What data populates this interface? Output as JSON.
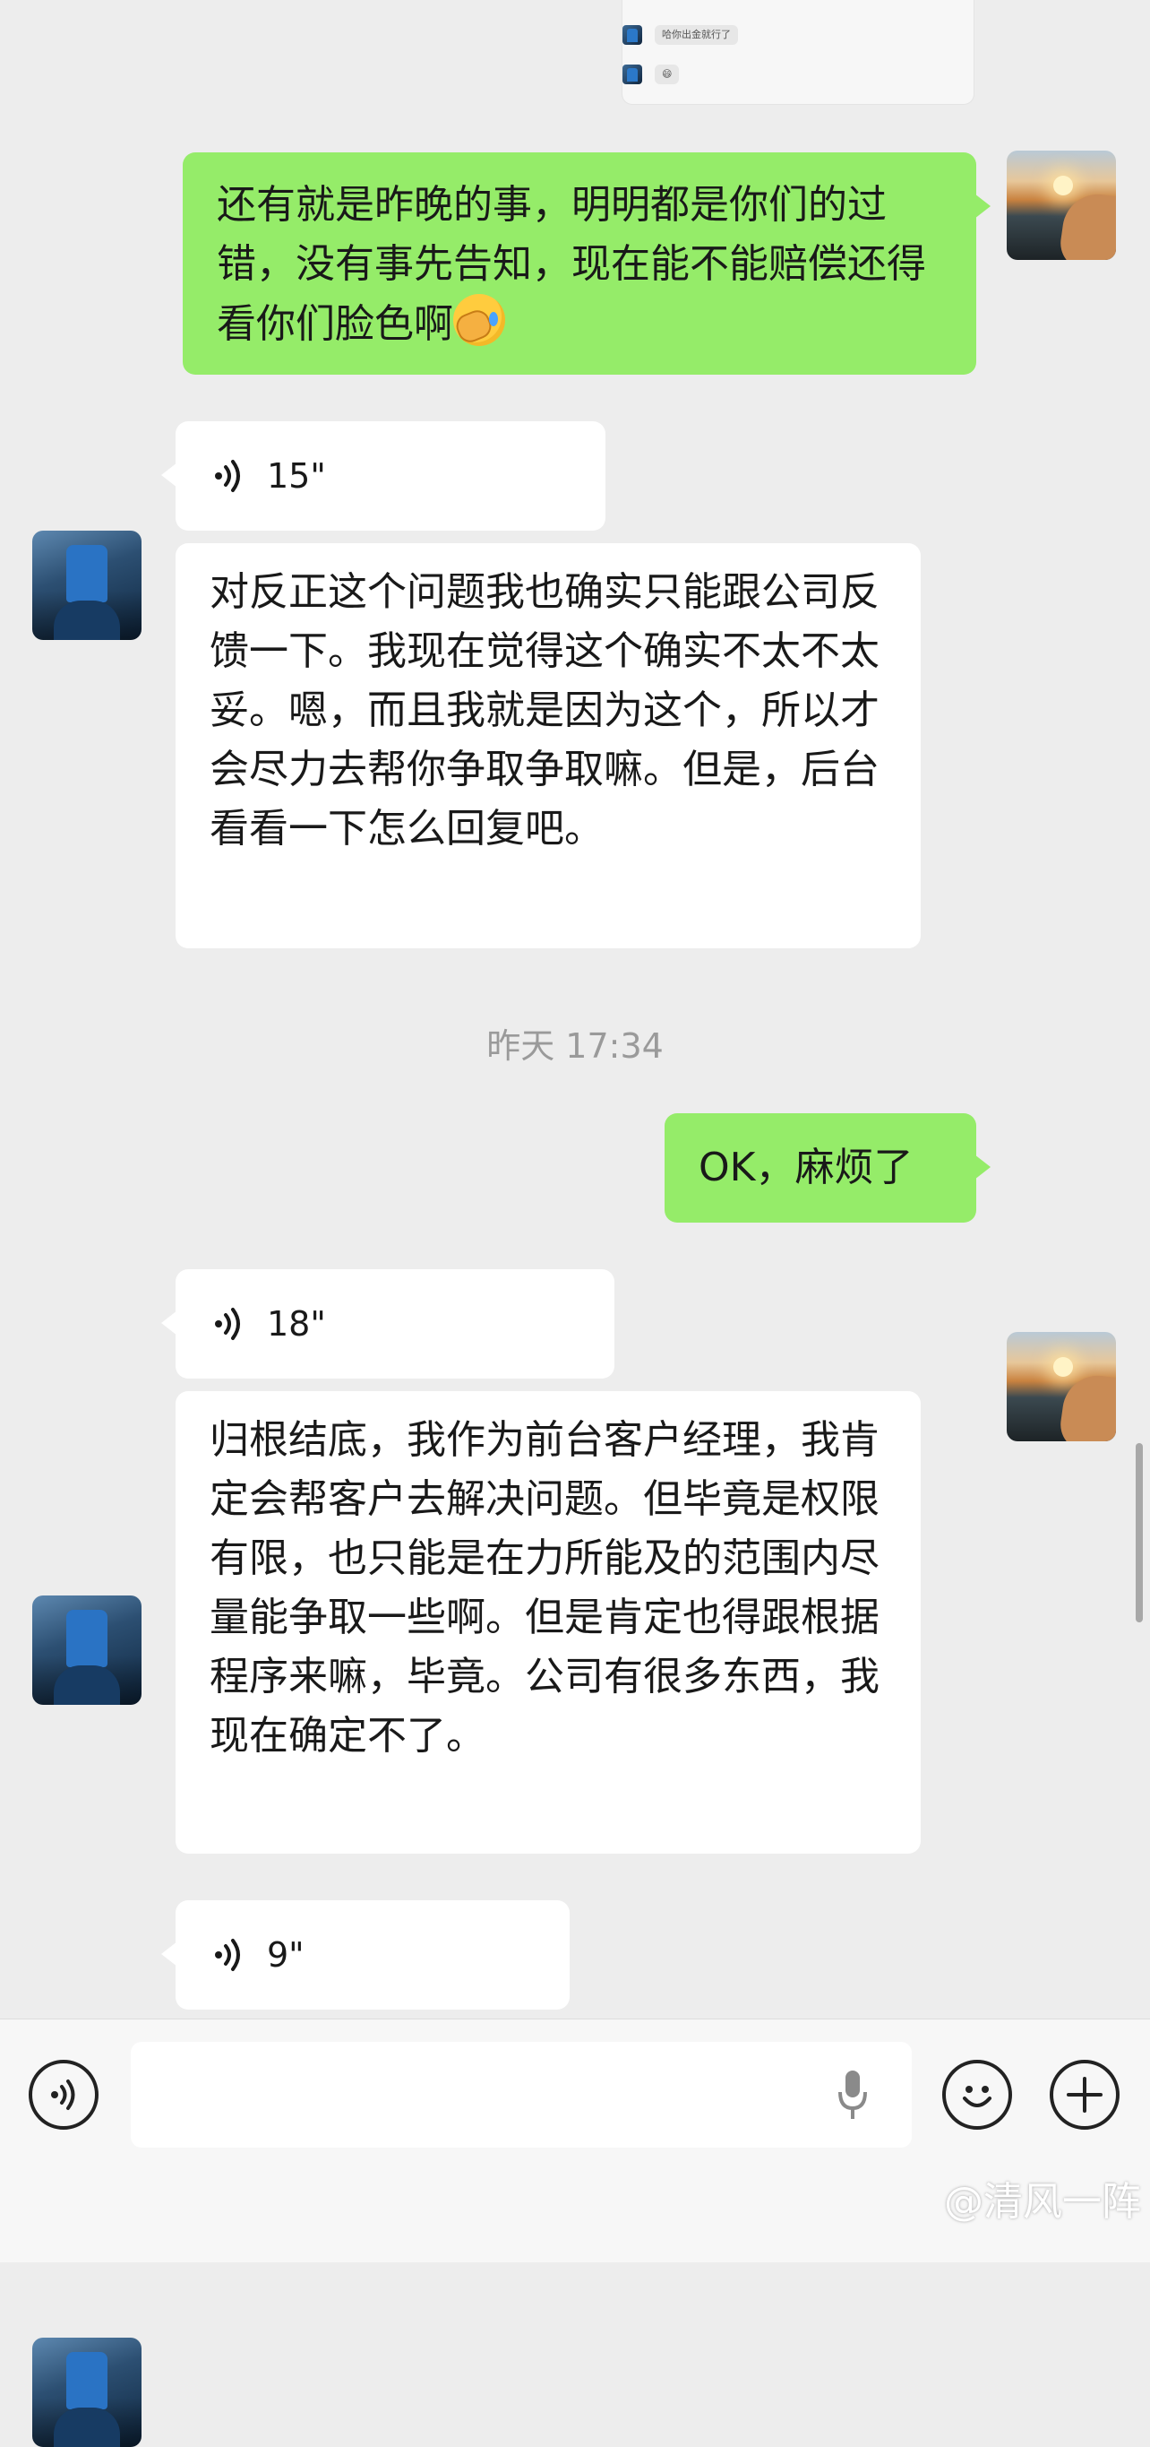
{
  "quote_card": {
    "row1_text": "哈你出金就行了",
    "row2_text": "😄"
  },
  "messages": {
    "m1": {
      "text": "还有就是昨晚的事，明明都是你们的过错，没有事先告知，现在能不能赔偿还得看你们脸色啊"
    },
    "v1": {
      "duration": "15\""
    },
    "m2": {
      "text": "对反正这个问题我也确实只能跟公司反馈一下。我现在觉得这个确实不太不太妥。嗯，而且我就是因为这个，所以才会尽力去帮你争取争取嘛。但是，后台看看一下怎么回复吧。"
    },
    "timestamp": "昨天 17:34",
    "m3": {
      "text": "OK，麻烦了"
    },
    "v2": {
      "duration": "18\""
    },
    "m4": {
      "text": "归根结底，我作为前台客户经理，我肯定会帮客户去解决问题。但毕竟是权限有限，也只能是在力所能及的范围内尽量能争取一些啊。但是肯定也得跟根据程序来嘛，毕竟。公司有很多东西，我现在确定不了。"
    },
    "v3": {
      "duration": "9\""
    }
  },
  "input_bar": {
    "placeholder": "",
    "icons": [
      "voice-mode-icon",
      "microphone-icon",
      "emoji-icon",
      "plus-icon"
    ]
  },
  "watermark": "@清风一阵",
  "colors": {
    "background": "#ededed",
    "sent_bubble": "#95ec69",
    "received_bubble": "#ffffff",
    "timestamp": "#9a9a9a"
  }
}
